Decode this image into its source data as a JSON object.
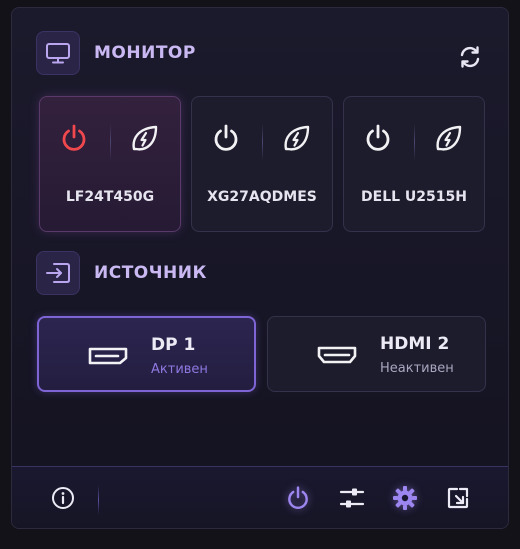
{
  "monitor_section": {
    "title": "МОНИТОР",
    "icon": "monitor-icon",
    "refresh_icon": "refresh-icon"
  },
  "monitors": [
    {
      "name": "LF24T450G",
      "power_state": "on",
      "power_color": "#f0484d",
      "active": true
    },
    {
      "name": "XG27AQDMES",
      "power_state": "off",
      "power_color": "#f2f2f5",
      "active": false
    },
    {
      "name": "DELL U2515H",
      "power_state": "off",
      "power_color": "#f2f2f5",
      "active": false
    }
  ],
  "source_section": {
    "title": "ИСТОЧНИК",
    "icon": "input-icon"
  },
  "sources": [
    {
      "label": "DP 1",
      "status": "Активен",
      "active": true,
      "icon": "displayport-icon"
    },
    {
      "label": "HDMI 2",
      "status": "Неактивен",
      "active": false,
      "icon": "hdmi-icon"
    }
  ],
  "footer": {
    "icons": [
      "info-icon",
      "power-icon",
      "sliders-icon",
      "settings-icon",
      "open-external-icon"
    ]
  },
  "colors": {
    "accent": "#9d86f0",
    "power_on": "#f0484d",
    "heading": "#c9b8f2"
  }
}
